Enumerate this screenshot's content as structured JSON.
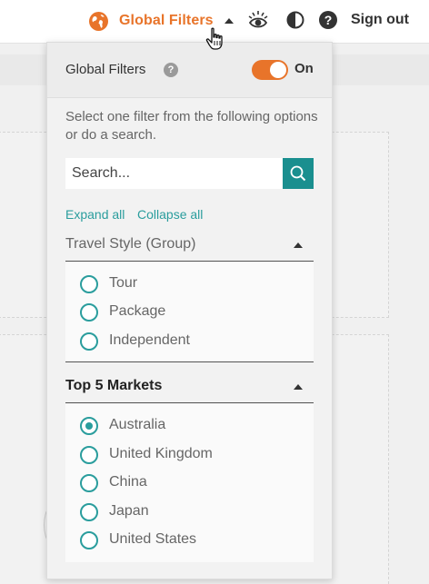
{
  "topbar": {
    "global_filters_label": "Global Filters",
    "sign_out_label": "Sign out",
    "help_icon": "?",
    "accent_color": "#e8742a",
    "icons": [
      "globe-icon",
      "caret-up-icon",
      "eye-icon",
      "contrast-icon",
      "help-icon",
      "hand-cursor-icon"
    ]
  },
  "panel": {
    "title": "Global Filters",
    "help_icon": "?",
    "toggle": {
      "state": true,
      "label": "On"
    },
    "instructions": "Select one filter from the following options or do a search.",
    "search": {
      "placeholder": "Search...",
      "value": ""
    },
    "expand_all": "Expand all",
    "collapse_all": "Collapse all",
    "groups": [
      {
        "title": "Travel Style (Group)",
        "bold": false,
        "expanded": true,
        "options": [
          "Tour",
          "Package",
          "Independent"
        ],
        "selected": null
      },
      {
        "title": "Top 5 Markets",
        "bold": true,
        "expanded": true,
        "options": [
          "Australia",
          "United Kingdom",
          "China",
          "Japan",
          "United States"
        ],
        "selected": "Australia"
      }
    ],
    "link_color": "#2a9d9d"
  }
}
